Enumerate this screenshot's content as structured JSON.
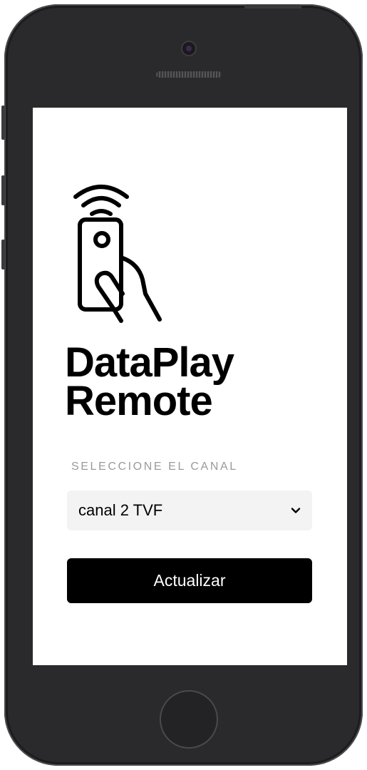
{
  "app": {
    "title_line1": "DataPlay",
    "title_line2": "Remote",
    "logo_icon": "remote-control-hand-wifi-icon"
  },
  "form": {
    "channel_label": "SELECCIONE EL CANAL",
    "selected_channel": "canal 2 TVF",
    "submit_label": "Actualizar"
  },
  "colors": {
    "button_bg": "#000000",
    "button_text": "#ffffff",
    "select_bg": "#f3f3f3",
    "label": "#9a9a9a",
    "device_frame": "#2a2a2c"
  }
}
